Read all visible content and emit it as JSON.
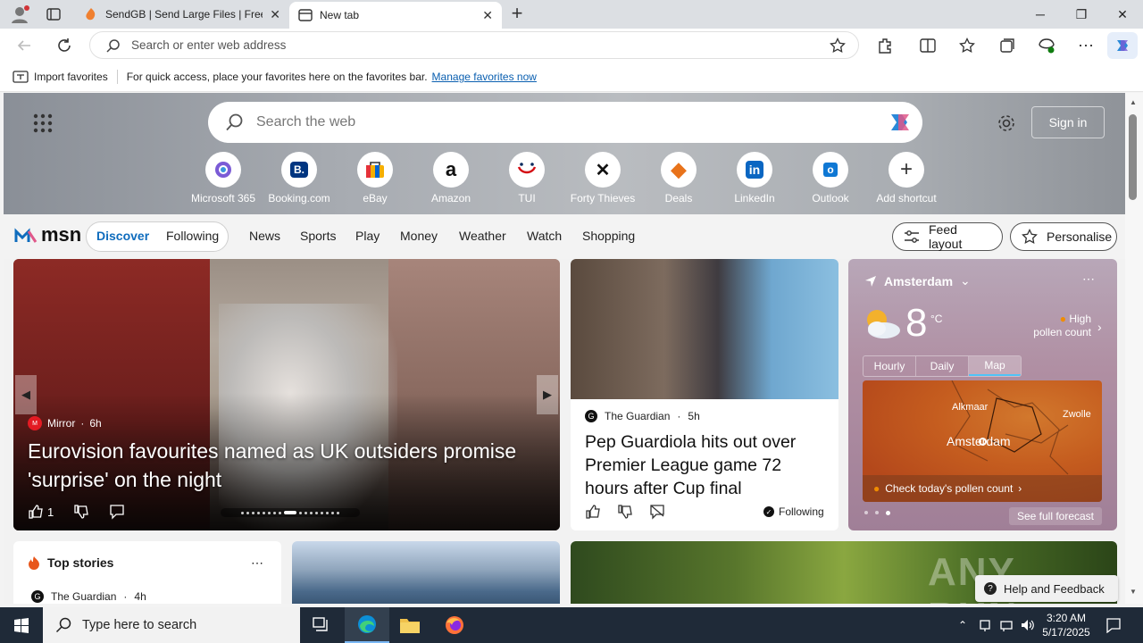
{
  "browser": {
    "tabs": [
      {
        "title": "SendGB | Send Large Files | Free f",
        "active": false
      },
      {
        "title": "New tab",
        "active": true
      }
    ],
    "address_placeholder": "Search or enter web address"
  },
  "favorites_bar": {
    "import_label": "Import favorites",
    "message": "For quick access, place your favorites here on the favorites bar.",
    "link": "Manage favorites now"
  },
  "newtab": {
    "search_placeholder": "Search the web",
    "signin": "Sign in",
    "shortcuts": [
      {
        "label": "Microsoft 365",
        "icon": "microsoft-365-icon"
      },
      {
        "label": "Booking.com",
        "icon": "booking-icon",
        "glyph": "B."
      },
      {
        "label": "eBay",
        "icon": "ebay-icon"
      },
      {
        "label": "Amazon",
        "icon": "amazon-icon",
        "glyph": "a"
      },
      {
        "label": "TUI",
        "icon": "tui-icon"
      },
      {
        "label": "Forty Thieves",
        "icon": "forty-thieves-icon",
        "glyph": "✕"
      },
      {
        "label": "Deals",
        "icon": "deals-icon",
        "glyph": "◆"
      },
      {
        "label": "LinkedIn",
        "icon": "linkedin-icon",
        "glyph": "in"
      },
      {
        "label": "Outlook",
        "icon": "outlook-icon",
        "glyph": "o"
      },
      {
        "label": "Add shortcut",
        "icon": "plus-icon",
        "glyph": "+"
      }
    ]
  },
  "msn": {
    "logo": "msn",
    "feed_tabs": [
      "Discover",
      "Following"
    ],
    "nav": [
      "News",
      "Sports",
      "Play",
      "Money",
      "Weather",
      "Watch",
      "Shopping"
    ],
    "feed_layout": "Feed layout",
    "personalise": "Personalise"
  },
  "hero_story": {
    "source": "Mirror",
    "age": "6h",
    "title": "Eurovision favourites named as UK outsiders promise 'surprise' on the night",
    "likes": "1"
  },
  "story2": {
    "source": "The Guardian",
    "age": "5h",
    "title": "Pep Guardiola hits out over Premier League game 72 hours after Cup final",
    "following": "Following"
  },
  "weather": {
    "location": "Amsterdam",
    "temp": "8",
    "unit": "°C",
    "pollen_line1": "High",
    "pollen_line2": "pollen count",
    "tabs": [
      "Hourly",
      "Daily",
      "Map"
    ],
    "active_tab": "Map",
    "map_labels": [
      "Alkmaar",
      "Zwolle",
      "Amsterdam"
    ],
    "pollen_cta": "Check today's pollen count",
    "forecast_link": "See full forecast"
  },
  "top_stories": {
    "heading": "Top stories",
    "source": "The Guardian",
    "age": "4h"
  },
  "watermark": "ANY RUN",
  "help": "Help and Feedback",
  "taskbar": {
    "search_placeholder": "Type here to search",
    "time": "3:20 AM",
    "date": "5/17/2025"
  },
  "colors": {
    "accent": "#0f6cbd",
    "taskbar": "#1f2a38",
    "hero_bg": "#a7abb1"
  }
}
